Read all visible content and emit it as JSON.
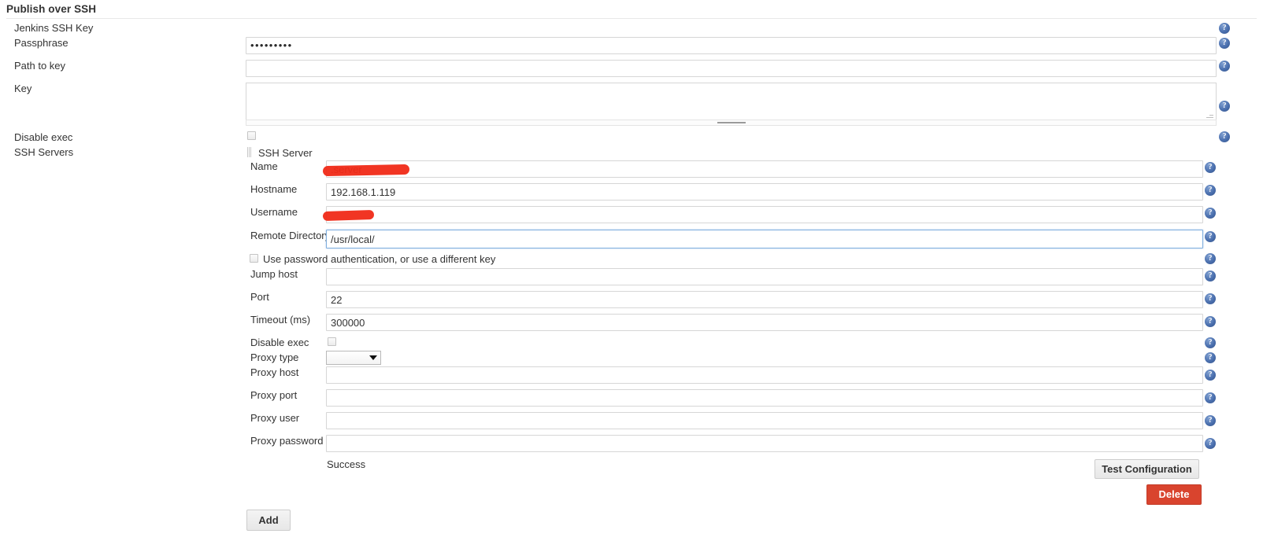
{
  "section": {
    "title": "Publish over SSH"
  },
  "outer_fields": {
    "jenkins_ssh_key_label": "Jenkins SSH Key",
    "passphrase_label": "Passphrase",
    "passphrase_value": "•••••••••",
    "path_to_key_label": "Path to key",
    "path_to_key_value": "",
    "key_label": "Key",
    "key_value": "",
    "disable_exec_label": "Disable exec",
    "ssh_servers_label": "SSH Servers"
  },
  "server": {
    "group_label": "SSH Server",
    "name_label": "Name",
    "name_value_visible": ".server",
    "hostname_label": "Hostname",
    "hostname_value": "192.168.1.119",
    "username_label": "Username",
    "username_value_visible": "",
    "remote_directory_label": "Remote Directory",
    "remote_directory_value": "/usr/local/",
    "use_password_label": "Use password authentication, or use a different key",
    "jump_host_label": "Jump host",
    "jump_host_value": "",
    "port_label": "Port",
    "port_value": "22",
    "timeout_label": "Timeout (ms)",
    "timeout_value": "300000",
    "disable_exec_label": "Disable exec",
    "proxy_type_label": "Proxy type",
    "proxy_type_value": "",
    "proxy_host_label": "Proxy host",
    "proxy_host_value": "",
    "proxy_port_label": "Proxy port",
    "proxy_port_value": "",
    "proxy_user_label": "Proxy user",
    "proxy_user_value": "",
    "proxy_password_label": "Proxy password",
    "proxy_password_value": "",
    "status_message": "Success"
  },
  "buttons": {
    "test_configuration": "Test Configuration",
    "delete": "Delete",
    "add": "Add"
  },
  "icons": {
    "help": "?"
  },
  "colors": {
    "delete_red": "#d9442e",
    "focus_blue": "#7eaede",
    "redaction_red": "#f02a17",
    "help_blue": "#4a6fae"
  }
}
